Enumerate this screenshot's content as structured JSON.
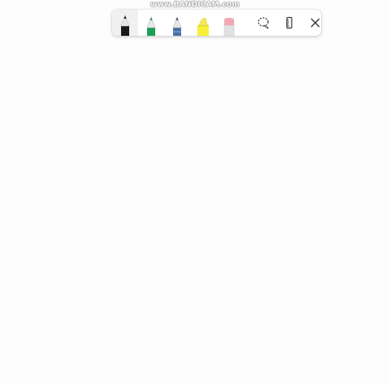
{
  "watermark": {
    "text": "www.BANDICAM.com"
  },
  "toolbar": {
    "tools": [
      {
        "name": "ballpoint-pen",
        "icon": "ballpoint-pen-icon",
        "color": "#1a1a1a",
        "selected": true
      },
      {
        "name": "pen-green",
        "icon": "pen-icon",
        "color": "#1e9e5a",
        "selected": false
      },
      {
        "name": "pencil",
        "icon": "pencil-icon",
        "color": "#4a6fa5",
        "selected": false
      },
      {
        "name": "highlighter",
        "icon": "highlighter-icon",
        "color": "#f7ef3a",
        "selected": false
      },
      {
        "name": "eraser",
        "icon": "eraser-icon",
        "color": "#f2a7b3",
        "selected": false
      }
    ],
    "actions": [
      {
        "name": "lasso-select",
        "icon": "lasso-select-icon"
      },
      {
        "name": "ruler",
        "icon": "ruler-icon"
      },
      {
        "name": "close",
        "icon": "close-icon"
      }
    ]
  }
}
